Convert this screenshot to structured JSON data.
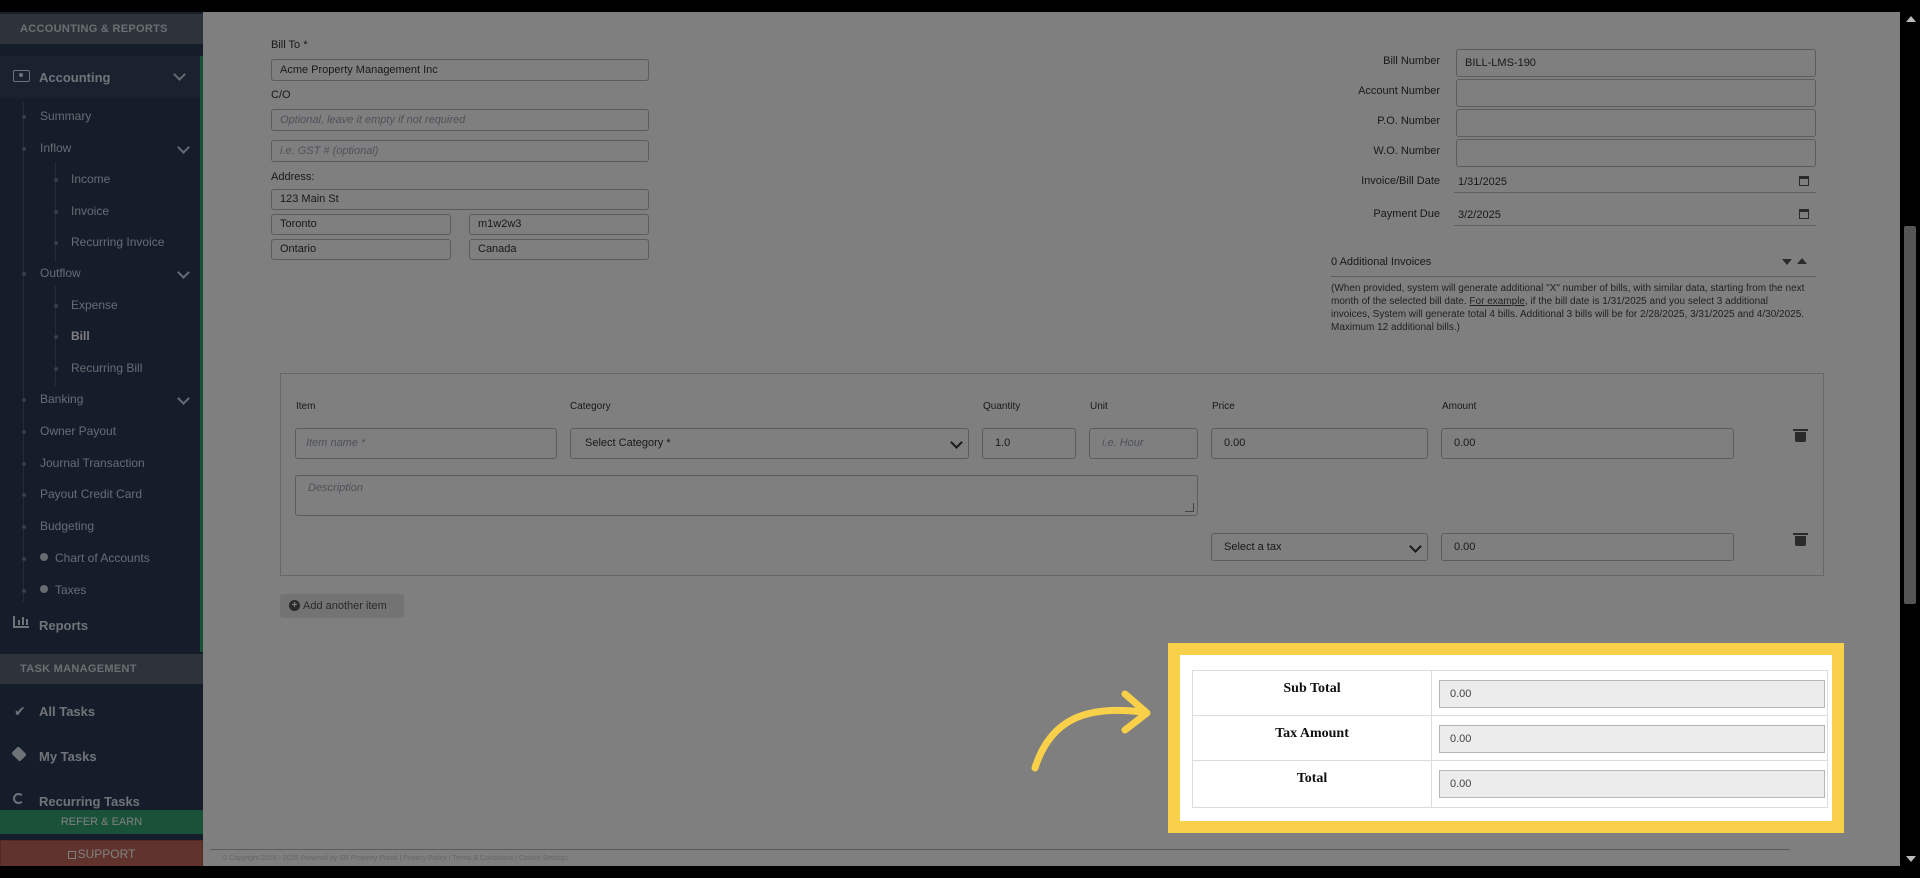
{
  "sidebar": {
    "sections": {
      "accounting_reports": "ACCOUNTING & REPORTS",
      "task_management": "TASK MANAGEMENT"
    },
    "accounting": "Accounting",
    "summary": "Summary",
    "inflow": "Inflow",
    "income": "Income",
    "invoice": "Invoice",
    "recurring_invoice": "Recurring Invoice",
    "outflow": "Outflow",
    "expense": "Expense",
    "bill": "Bill",
    "recurring_bill": "Recurring Bill",
    "banking": "Banking",
    "owner_payout": "Owner Payout",
    "journal_transaction": "Journal Transaction",
    "payout_credit_card": "Payout Credit Card",
    "budgeting": "Budgeting",
    "chart_of_accounts": "Chart of Accounts",
    "taxes": "Taxes",
    "reports": "Reports",
    "all_tasks": "All Tasks",
    "my_tasks": "My Tasks",
    "recurring_tasks": "Recurring Tasks",
    "refer_earn": "REFER & EARN",
    "support": "SUPPORT"
  },
  "form": {
    "bill_to_label": "Bill To *",
    "bill_to_value": "Acme Property Management Inc",
    "co_label": "C/O",
    "co_placeholder": "Optional, leave it empty if not required",
    "tax_id_placeholder": "i.e. GST # (optional)",
    "address_label": "Address:",
    "street": "123 Main St",
    "city": "Toronto",
    "postal": "m1w2w3",
    "province": "Ontario",
    "country": "Canada",
    "bill_number_label": "Bill Number",
    "bill_number_value": "BILL-LMS-190",
    "account_number_label": "Account Number",
    "po_number_label": "P.O. Number",
    "wo_number_label": "W.O. Number",
    "invoice_date_label": "Invoice/Bill Date",
    "invoice_date_value": "1/31/2025",
    "payment_due_label": "Payment Due",
    "payment_due_value": "3/2/2025",
    "additional_invoices": "0 Additional Invoices",
    "additional_note_pre": "(When provided, system will generate additional \"X\" number of bills, with similar data, starting from the next month of the selected bill date. ",
    "additional_note_link": "For example",
    "additional_note_post": ", if the bill date is 1/31/2025 and you select 3 additional invoices, System will generate total 4 bills. Additional 3 bills will be for 2/28/2025, 3/31/2025 and 4/30/2025. Maximum 12 additional bills.)"
  },
  "items": {
    "headers": {
      "item": "Item",
      "category": "Category",
      "quantity": "Quantity",
      "unit": "Unit",
      "price": "Price",
      "amount": "Amount"
    },
    "item_placeholder": "Item name *",
    "category_value": "Select Category *",
    "quantity_value": "1.0",
    "unit_placeholder": "i.e. Hour",
    "price_value": "0.00",
    "amount_value": "0.00",
    "description_placeholder": "Description",
    "tax_select": "Select a tax",
    "tax_amount": "0.00",
    "add_item": "Add another item"
  },
  "totals": {
    "sub_total_label": "Sub Total",
    "sub_total_value": "0.00",
    "tax_amount_label": "Tax Amount",
    "tax_amount_value": "0.00",
    "total_label": "Total",
    "total_value": "0.00"
  },
  "footer": "© Copyright 2016 - 2025 Powered by SR Property Portal | Privacy Policy | Terms & Conditions | Cookie Settings",
  "colors": {
    "highlight": "#f8d04a",
    "sidebar": "#2b3a55",
    "accent_green": "#2ea36d",
    "support": "#c0685a"
  }
}
